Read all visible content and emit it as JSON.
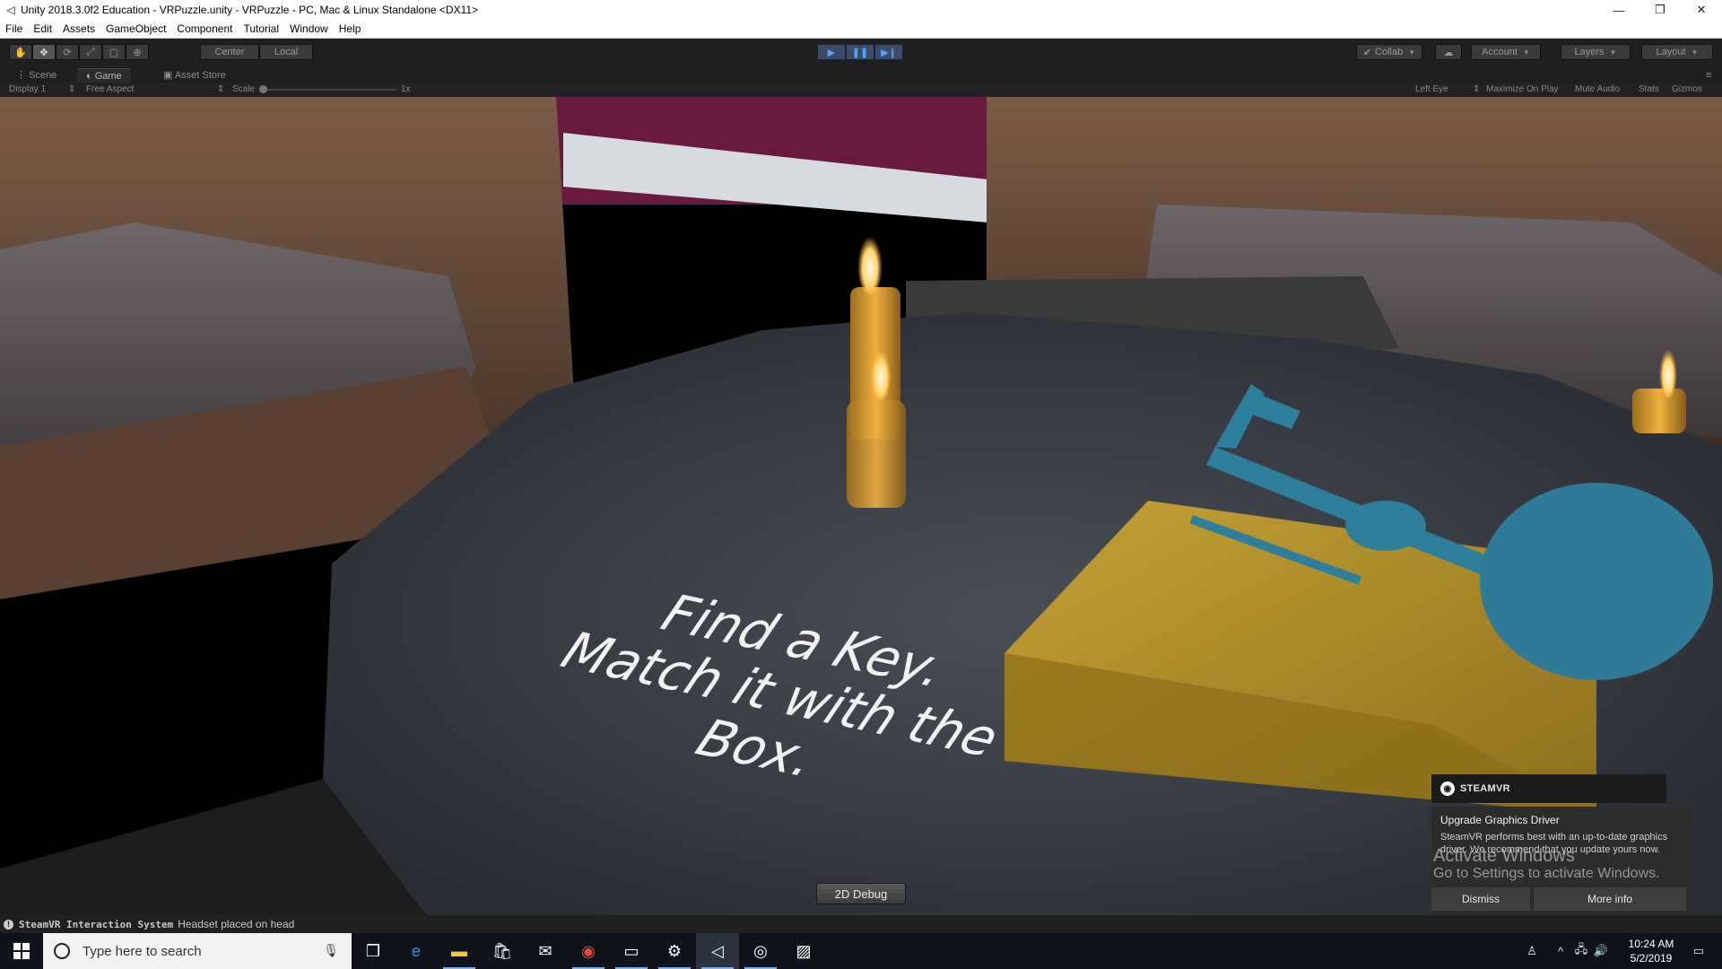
{
  "window": {
    "title": "Unity 2018.3.0f2 Education - VRPuzzle.unity - VRPuzzle - PC, Mac & Linux Standalone <DX11>",
    "controls": [
      "—",
      "❐",
      "✕"
    ]
  },
  "menu": [
    "File",
    "Edit",
    "Assets",
    "GameObject",
    "Component",
    "Tutorial",
    "Window",
    "Help"
  ],
  "toolbar": {
    "pivot_label": "Center",
    "space_label": "Local",
    "collab_label": "Collab",
    "account_label": "Account",
    "layers_label": "Layers",
    "layout_label": "Layout"
  },
  "tabs": [
    "Scene",
    "Game",
    "Asset Store"
  ],
  "game_bar": {
    "display": "Display 1",
    "aspect": "Free Aspect",
    "scale_label": "Scale",
    "scale_value": "1x",
    "eye": "Left Eye",
    "maximize": "Maximize On Play",
    "mute": "Mute Audio",
    "stats": "Stats",
    "gizmos": "Gizmos"
  },
  "scene": {
    "floor_text": [
      "Find a Key.",
      "Match it with the",
      "Box."
    ],
    "debug_button": "2D Debug"
  },
  "steamvr": {
    "brand": "STEAMVR",
    "title": "Upgrade Graphics Driver",
    "message": "SteamVR performs best with an up-to-date graphics driver. We recommend that you update yours now.",
    "dismiss": "Dismiss",
    "more_info": "More info"
  },
  "activation": {
    "line1": "Activate Windows",
    "line2": "Go to Settings to activate Windows."
  },
  "status": {
    "source": "SteamVR Interaction System",
    "message": "Headset placed on head"
  },
  "taskbar": {
    "search_placeholder": "Type here to search",
    "time": "10:24 AM",
    "date": "5/2/2019"
  },
  "colors": {
    "play_blue": "#4fa3ff",
    "key_blue": "#2d7f9c",
    "box_gold": "#b08e2a",
    "table_gray": "#3c4048"
  }
}
